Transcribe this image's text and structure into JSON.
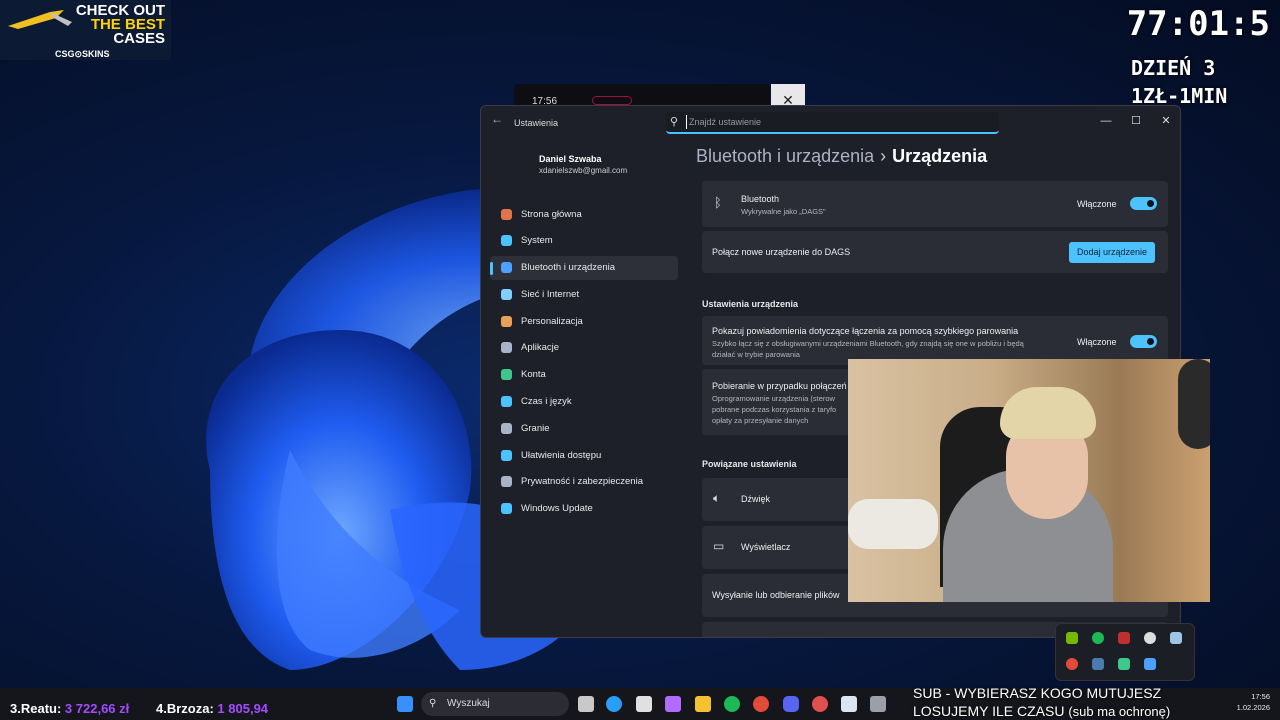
{
  "promo": {
    "line1": "CHECK OUT",
    "line2": "THE BEST",
    "line3": "CASES",
    "brand": "CSG⊙SKINS"
  },
  "timer": "77:01:5",
  "stream_info": {
    "day": "DZIEŃ 3",
    "rate": "1ZŁ-1MIN"
  },
  "phone_window": {
    "time": "17:56"
  },
  "settings": {
    "app_title": "Ustawienia",
    "search_placeholder": "Znajdź ustawienie",
    "user": {
      "name": "Daniel Szwaba",
      "email": "xdanielszwb@gmail.com"
    },
    "nav": [
      {
        "label": "Strona główna",
        "icon": "home-icon",
        "color": "#e0734a"
      },
      {
        "label": "System",
        "icon": "system-icon",
        "color": "#4cc2ff"
      },
      {
        "label": "Bluetooth i urządzenia",
        "icon": "bluetooth-icon",
        "color": "#4ca0ff",
        "selected": true
      },
      {
        "label": "Sieć i Internet",
        "icon": "wifi-icon",
        "color": "#7fd0ff"
      },
      {
        "label": "Personalizacja",
        "icon": "brush-icon",
        "color": "#e8a05a"
      },
      {
        "label": "Aplikacje",
        "icon": "apps-icon",
        "color": "#aab4c8"
      },
      {
        "label": "Konta",
        "icon": "account-icon",
        "color": "#3cc88c"
      },
      {
        "label": "Czas i język",
        "icon": "globe-icon",
        "color": "#4cc2ff"
      },
      {
        "label": "Granie",
        "icon": "gamepad-icon",
        "color": "#aab4c8"
      },
      {
        "label": "Ułatwienia dostępu",
        "icon": "accessibility-icon",
        "color": "#4cc2ff"
      },
      {
        "label": "Prywatność i zabezpieczenia",
        "icon": "shield-icon",
        "color": "#aab4c8"
      },
      {
        "label": "Windows Update",
        "icon": "update-icon",
        "color": "#4cc2ff"
      }
    ],
    "breadcrumb": {
      "parent": "Bluetooth i urządzenia",
      "separator": "›",
      "current": "Urządzenia"
    },
    "bluetooth": {
      "title": "Bluetooth",
      "subtitle": "Wykrywalne jako „DAGS\"",
      "state": "Włączone"
    },
    "add_device": {
      "title": "Połącz nowe urządzenie do DAGS",
      "button": "Dodaj urządzenie"
    },
    "device_settings_header": "Ustawienia urządzenia",
    "swift_pair": {
      "title": "Pokazuj powiadomienia dotyczące łączenia za pomocą szybkiego parowania",
      "desc1": "Szybko łącz się z obsługiwanymi urządzeniami Bluetooth, gdy znajdą się one w pobliżu i będą",
      "desc2": "działać w trybie parowania",
      "state": "Włączone"
    },
    "metered": {
      "title": "Pobieranie w przypadku połączeń",
      "desc1": "Oprogramowanie urządzenia (sterow",
      "desc2": "pobrane podczas korzystania z taryfo",
      "desc3": "opłaty za przesyłanie danych"
    },
    "related_header": "Powiązane ustawienia",
    "related": [
      {
        "label": "Dźwięk",
        "icon": "speaker-icon"
      },
      {
        "label": "Wyświetlacz",
        "icon": "monitor-icon"
      },
      {
        "label": "Wysyłanie lub odbieranie plików",
        "icon": ""
      }
    ]
  },
  "taskbar": {
    "search": "Wyszukaj",
    "time": "17:56",
    "date": "1.02.2026"
  },
  "leaderboard": [
    {
      "rank": "3.Reatu:",
      "amount": "3 722,66 zł"
    },
    {
      "rank": "4.Brzoza:",
      "amount": "1 805,94"
    }
  ],
  "banner": {
    "line1": "SUB - WYBIERASZ KOGO MUTUJESZ",
    "line2a": "LOSUJEMY ILE CZASU",
    "line2b": "(sub ma ochronę)"
  }
}
